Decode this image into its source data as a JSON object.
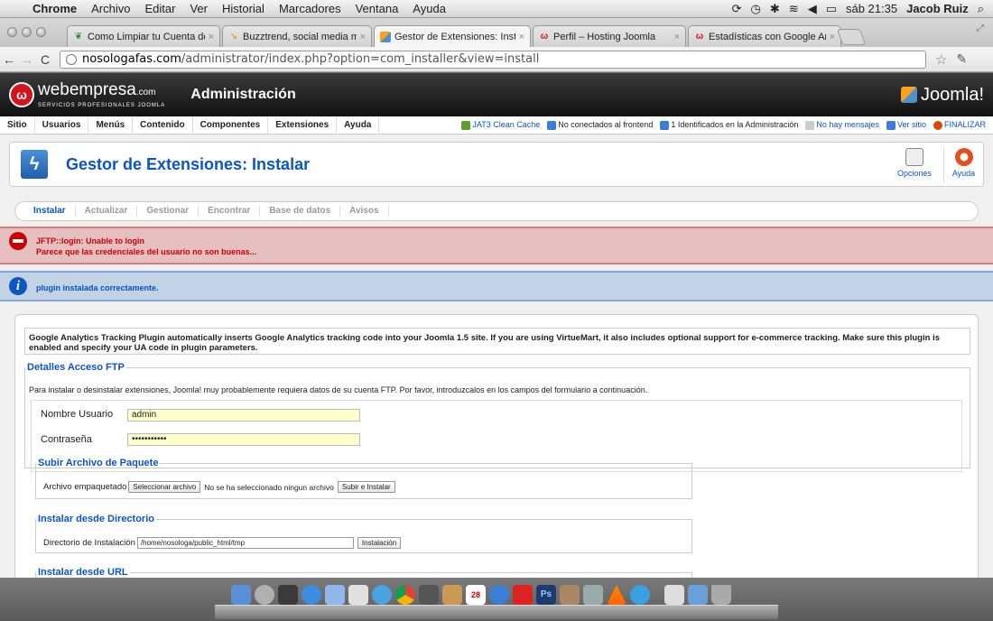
{
  "macmenu": {
    "app": "Chrome",
    "items": [
      "Archivo",
      "Editar",
      "Ver",
      "Historial",
      "Marcadores",
      "Ventana",
      "Ayuda"
    ],
    "clock": "sáb 21:35",
    "user": "Jacob Ruiz"
  },
  "tabs": [
    {
      "title": "Como Limpiar tu Cuenta de",
      "icon": "leaf-icon"
    },
    {
      "title": "Buzztrend, social media mar",
      "icon": "arrow-icon"
    },
    {
      "title": "Gestor de Extensiones: Insta",
      "icon": "joomla-icon",
      "active": true
    },
    {
      "title": "Perfil – Hosting Joomla",
      "icon": "webempresa-icon"
    },
    {
      "title": "Estadísticas con Google Ana",
      "icon": "webempresa-icon"
    }
  ],
  "address": {
    "host": "nosologafas.com",
    "path": "/administrator/index.php?option=com_installer&view=install"
  },
  "header": {
    "brand": "webempresa",
    "brand_suffix": ".com",
    "brand_tag": "SERVICIOS PROFESIONALES JOOMLA",
    "admin": "Administración",
    "joomla": "Joomla!"
  },
  "menu": [
    "Sitio",
    "Usuarios",
    "Menús",
    "Contenido",
    "Componentes",
    "Extensiones",
    "Ayuda"
  ],
  "status": {
    "cache": "JAT3 Clean Cache",
    "frontend": "No conectados al frontend",
    "admins": "1 Identificados en la Administración",
    "messages": "No hay mensajes",
    "site": "Ver sitio",
    "logout": "FINALIZAR"
  },
  "page": {
    "title": "Gestor de Extensiones: Instalar",
    "options": "Opciones",
    "help": "Ayuda"
  },
  "subnav": [
    "Instalar",
    "Actualizar",
    "Gestionar",
    "Encontrar",
    "Base de datos",
    "Avisos"
  ],
  "error": {
    "line1": "JFTP::login: Unable to login",
    "line2": "Parece que las credenciales del usuario no son buenas..."
  },
  "info": "plugin instalada correctamente.",
  "description": "Google Analytics Tracking Plugin automatically inserts Google Analytics tracking code into your Joomla 1.5 site. If you are using VirtueMart, it also includes optional support for e-commerce tracking. Make sure this plugin is enabled and specify your UA code in plugin parameters.",
  "ftp": {
    "legend": "Detalles Acceso FTP",
    "note": "Para instalar o desinstalar extensiones, Joomla! muy probablemente requiera datos de su cuenta FTP. Por favor, introduzcalos en los campos del formulario a continuación.",
    "user_label": "Nombre Usuario",
    "user_value": "admin",
    "pass_label": "Contraseña",
    "pass_value": "•••••••••••"
  },
  "upload": {
    "legend": "Subir Archivo de Paquete",
    "label": "Archivo empaquetado",
    "choose": "Seleccionar archivo",
    "none": "No se ha seleccionado ningun archivo",
    "button": "Subir e Instalar"
  },
  "directory": {
    "legend": "Instalar desde Directorio",
    "label": "Directorio de Instalación",
    "value": "/home/nosologa/public_html/tmp",
    "button": "Instalación"
  },
  "url": {
    "legend": "Instalar desde URL"
  },
  "dock_calendar": "28",
  "dock_ps": "Ps"
}
